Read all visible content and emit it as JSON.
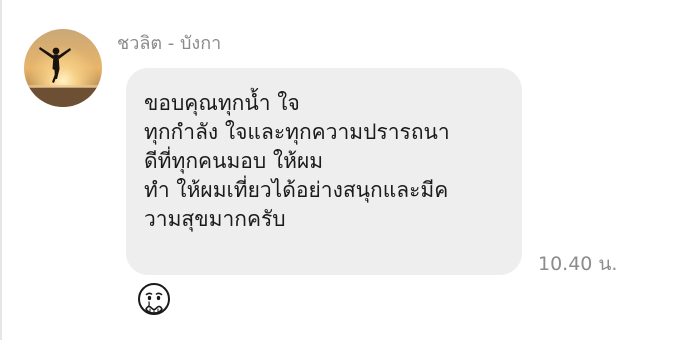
{
  "chat": {
    "sender": {
      "name": "ชวลิต",
      "separator": " - ",
      "status": "บังกา"
    },
    "message": {
      "lines": [
        "ขอบคุณทุกน้ำ ใจ",
        "ทุกกำลัง ใจและทุกความปรารถนา",
        "ดีที่ทุกคนมอบ ให้ผม",
        "ทำ ให้ผมเที่ยวได้อย่างสนุกและมีค",
        "วามสุขมากครับ"
      ],
      "time": "10.40 น."
    },
    "avatar_icon": "avatar-photo-sunset-jump",
    "reaction_icon": "emoji-moved-icon"
  },
  "colors": {
    "bubble": "#eeeeee",
    "text": "#1b1b1b",
    "muted": "#8a8a8a"
  }
}
